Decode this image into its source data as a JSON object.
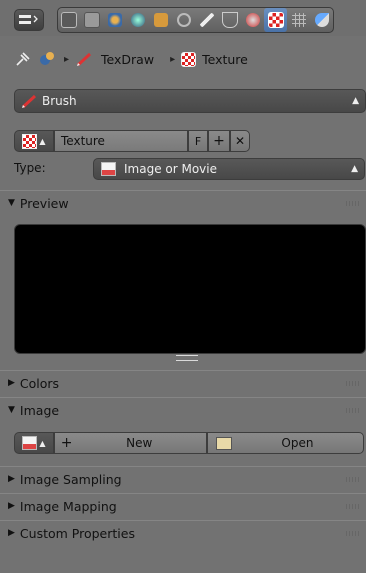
{
  "breadcrumb": {
    "brush_name": "TexDraw",
    "texture_name": "Texture"
  },
  "brush_selector": {
    "label": "Brush"
  },
  "texture_block": {
    "name": "Texture",
    "fake_user": "F"
  },
  "type_field": {
    "label": "Type:",
    "value": "Image or Movie"
  },
  "panels": {
    "preview": "Preview",
    "colors": "Colors",
    "image": "Image",
    "image_sampling": "Image Sampling",
    "image_mapping": "Image Mapping",
    "custom_properties": "Custom Properties"
  },
  "image_controls": {
    "new_label": "New",
    "open_label": "Open"
  },
  "colors": {
    "accent": "#4a72a8",
    "panel_bg": "#727272"
  }
}
